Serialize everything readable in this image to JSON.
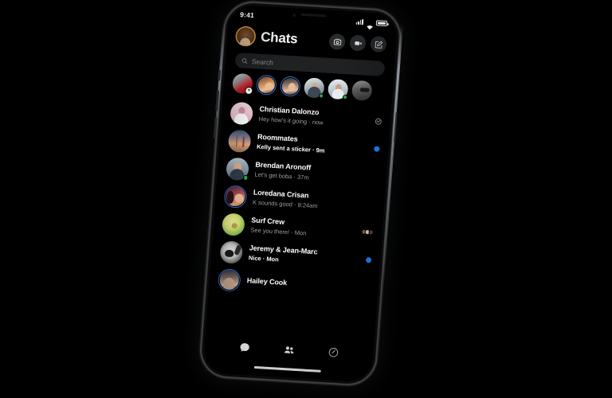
{
  "device": {
    "status_bar": {
      "time": "9:41",
      "signal_icon": "cellular-bars-icon",
      "wifi_icon": "wifi-icon",
      "battery_icon": "battery-icon"
    },
    "home_indicator": "home-indicator"
  },
  "header": {
    "title": "Chats",
    "avatar_name": "profile-avatar",
    "actions": [
      {
        "name": "camera-button",
        "icon": "camera-icon"
      },
      {
        "name": "video-call-button",
        "icon": "video-camera-icon"
      },
      {
        "name": "compose-button",
        "icon": "compose-pencil-icon"
      }
    ]
  },
  "search": {
    "placeholder": "Search",
    "icon": "search-icon"
  },
  "stories": [
    {
      "name": "your-story",
      "art": "s-red",
      "ring": false,
      "badge": "plus",
      "plus": "+",
      "active": false
    },
    {
      "name": "story-1",
      "art": "s-w1",
      "ring": true,
      "badge": "none",
      "active": false
    },
    {
      "name": "story-2",
      "art": "s-w2",
      "ring": true,
      "badge": "none",
      "active": false
    },
    {
      "name": "story-3",
      "art": "s-m1",
      "ring": false,
      "badge": "none",
      "active": true
    },
    {
      "name": "story-4",
      "art": "s-w3",
      "ring": false,
      "badge": "none",
      "active": true
    },
    {
      "name": "story-5",
      "art": "s-w4",
      "ring": false,
      "badge": "none",
      "active": false
    }
  ],
  "chats": [
    {
      "name": "Christian Dalonzo",
      "preview": "Hey how's it going · now",
      "art": "a-pink",
      "ring": false,
      "active": false,
      "unread": false,
      "status": "read-receipt"
    },
    {
      "name": "Roommates",
      "preview": "Kelly sent a sticker · 9m",
      "art": "a-bridge",
      "ring": false,
      "active": false,
      "unread": true,
      "status": "unread-dot"
    },
    {
      "name": "Brendan Aronoff",
      "preview": "Let's get boba · 37m",
      "art": "a-man1",
      "ring": false,
      "active": true,
      "unread": false,
      "status": "none"
    },
    {
      "name": "Loredana Crisan",
      "preview": "K sounds good · 8:24am",
      "art": "a-lore",
      "ring": true,
      "active": false,
      "unread": false,
      "status": "none"
    },
    {
      "name": "Surf Crew",
      "preview": "See you there! · Mon",
      "art": "a-avo",
      "ring": false,
      "active": false,
      "unread": false,
      "status": "seen-pile"
    },
    {
      "name": "Jeremy & Jean-Marc",
      "preview": "Nice · Mon",
      "art": "a-jer",
      "ring": false,
      "active": false,
      "unread": true,
      "status": "unread-dot"
    },
    {
      "name": "Hailey Cook",
      "preview": "",
      "art": "a-hail",
      "ring": true,
      "active": false,
      "unread": false,
      "status": "none"
    }
  ],
  "tabbar": [
    {
      "name": "tab-chats",
      "icon": "chat-bubble-icon",
      "selected": true
    },
    {
      "name": "tab-people",
      "icon": "people-icon",
      "selected": false
    },
    {
      "name": "tab-discover",
      "icon": "discover-compass-icon",
      "selected": false
    }
  ],
  "colors": {
    "background": "#000000",
    "accent_blue": "#1b84f5",
    "story_ring": "#2b6fd4",
    "active_green": "#31a24c",
    "surface": "#1f2123",
    "text_primary": "#ffffff",
    "text_secondary": "#9a9ca0"
  }
}
